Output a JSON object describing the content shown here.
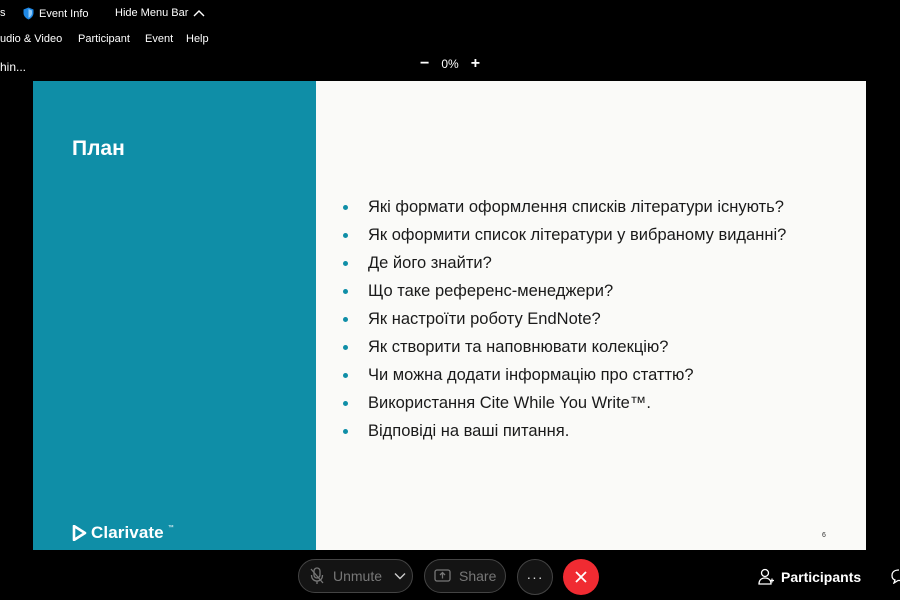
{
  "topbar": {
    "partial_left": "s",
    "event_info": "Event Info",
    "hide_menu_bar": "Hide Menu Bar"
  },
  "menubar": {
    "items": [
      "udio & Video",
      "Participant",
      "Event",
      "Help"
    ]
  },
  "status": {
    "partial_text": "hin...",
    "zoom_minus": "−",
    "zoom_value": "0%",
    "zoom_plus": "+"
  },
  "slide": {
    "title": "План",
    "bullets": [
      "Які формати оформлення списків літератури існують?",
      "Як оформити список літератури у вибраному виданні?",
      "Де його знайти?",
      "Що таке референс-менеджери?",
      "Як настроїти роботу EndNote?",
      "Як створити та наповнювати колекцію?",
      "Чи можна додати інформацію про статтю?",
      "Використання Cite While You Write™.",
      "Відповіді на ваші питання."
    ],
    "logo_text": "Clarivate",
    "logo_tm": "™",
    "page_number": "6",
    "colors": {
      "accent": "#0f8ea7",
      "background": "#fafaf8"
    }
  },
  "controls": {
    "unmute_label": "Unmute",
    "share_label": "Share",
    "more_label": "···",
    "participants_label": "Participants",
    "end_call_color": "#f02b32"
  }
}
